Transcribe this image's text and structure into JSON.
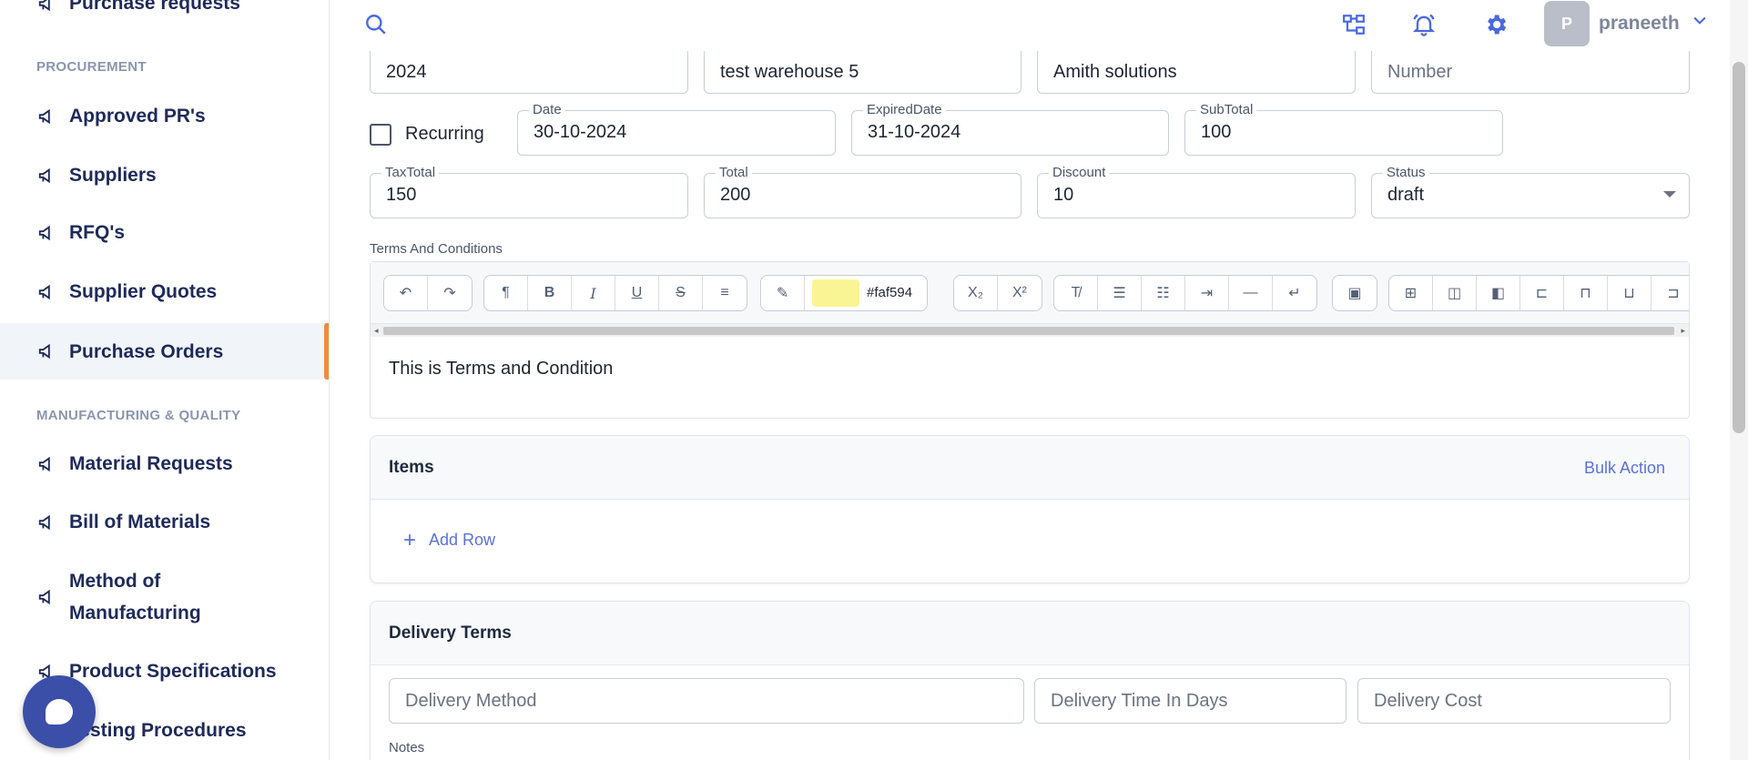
{
  "sidebar": {
    "top_item": "Purchase requests",
    "sections": [
      {
        "title": "PROCUREMENT"
      },
      {
        "title": "MANUFACTURING & QUALITY"
      }
    ],
    "items": [
      {
        "label": "Approved PR's"
      },
      {
        "label": "Suppliers"
      },
      {
        "label": "RFQ's"
      },
      {
        "label": "Supplier Quotes"
      },
      {
        "label": "Purchase Orders",
        "active": true
      },
      {
        "label": "Material Requests"
      },
      {
        "label": "Bill of Materials"
      },
      {
        "label": "Method of"
      },
      {
        "label": "Product Specifications"
      },
      {
        "label": "Testing Procedures"
      }
    ],
    "method_line2": "Manufacturing"
  },
  "topbar": {
    "user_initial": "P",
    "username": "praneeth",
    "icons": [
      "search-icon",
      "org-chart-icon",
      "bell-icon",
      "gear-icon",
      "chevron-down-icon"
    ]
  },
  "form": {
    "row1": {
      "year_value": "2024",
      "warehouse_value": "test warehouse 5",
      "supplier_value": "Amith solutions",
      "number_placeholder": "Number"
    },
    "recurring_label": "Recurring",
    "date": {
      "label": "Date",
      "value": "30-10-2024"
    },
    "expired_date": {
      "label": "ExpiredDate",
      "value": "31-10-2024"
    },
    "subtotal": {
      "label": "SubTotal",
      "value": "100"
    },
    "taxtotal": {
      "label": "TaxTotal",
      "value": "150"
    },
    "total": {
      "label": "Total",
      "value": "200"
    },
    "discount": {
      "label": "Discount",
      "value": "10"
    },
    "status": {
      "label": "Status",
      "value": "draft"
    },
    "terms_label": "Terms And Conditions"
  },
  "editor": {
    "color_hex": "#faf594",
    "content": "This is Terms and Condition"
  },
  "items_card": {
    "title": "Items",
    "bulk_action": "Bulk Action",
    "add_row": "Add Row"
  },
  "delivery_card": {
    "title": "Delivery Terms",
    "method_placeholder": "Delivery Method",
    "days_placeholder": "Delivery Time In Days",
    "cost_placeholder": "Delivery Cost",
    "notes_label": "Notes"
  },
  "colors": {
    "accent": "#4a68e0",
    "nav_text": "#1e2a5a",
    "active_bar": "#f28c38",
    "chat_bubble": "#3b4fa8"
  }
}
